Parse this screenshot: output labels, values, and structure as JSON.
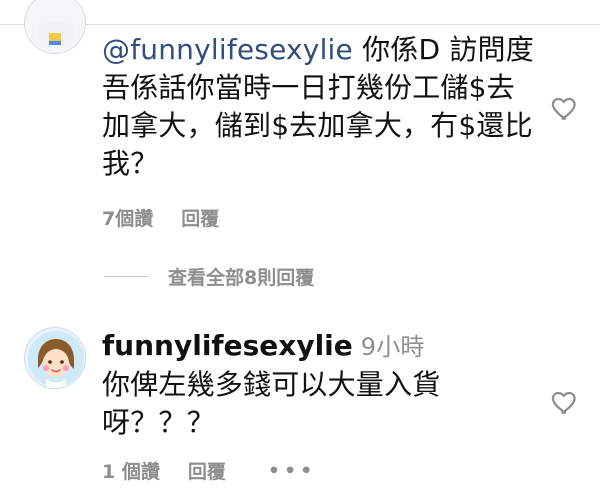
{
  "comments": [
    {
      "mention": "@funnylifesexylie",
      "text": " 你係D 訪問度吾係話你當時一日打幾份工儲$去加拿大，儲到$去加拿大，冇$還比我？",
      "likes": "7個讚",
      "reply": "回覆"
    },
    {
      "username": "funnylifesexylie",
      "time": "9小時",
      "text": "你俾左幾多錢可以大量入貨呀？？？",
      "likes": "1 個讚",
      "reply": "回覆",
      "more": "•••"
    }
  ],
  "view_replies": "查看全部8則回覆",
  "icons": {
    "heart": "heart-icon",
    "avatar": "avatar",
    "more": "more-icon"
  },
  "colors": {
    "mention": "#304f7d",
    "meta": "#8e8e8e",
    "text": "#111111",
    "divider": "#dedede"
  }
}
